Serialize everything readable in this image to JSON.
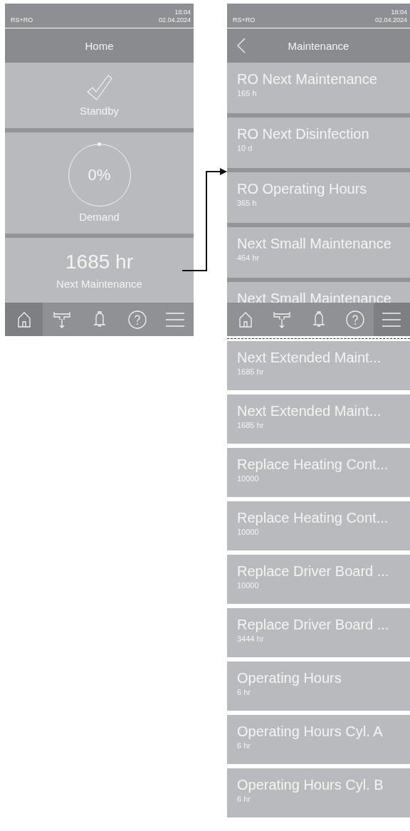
{
  "home_screen": {
    "status": {
      "system": "RS+RO",
      "time": "18:04",
      "date": "02.04.2024"
    },
    "back_button": false,
    "title": "Home",
    "tiles": [
      {
        "kind": "status",
        "label": "Standby"
      },
      {
        "kind": "gauge",
        "value": "0%",
        "label": "Demand"
      },
      {
        "kind": "value",
        "value": "1685 hr",
        "label": "Next Maintenance"
      }
    ],
    "nav": [
      {
        "kind": "home",
        "selected": true
      },
      {
        "kind": "valve",
        "selected": false
      },
      {
        "kind": "bell",
        "selected": false
      },
      {
        "kind": "help",
        "selected": false
      },
      {
        "kind": "menu",
        "selected": false
      }
    ]
  },
  "maintenance_screen": {
    "status": {
      "system": "RS+RO",
      "time": "18:04",
      "date": "02.04.2024"
    },
    "back_button": true,
    "title": "Maintenance",
    "items": [
      {
        "title": "RO Next Maintenance",
        "value": "165 h"
      },
      {
        "title": "RO Next Disinfection",
        "value": "10 d"
      },
      {
        "title": "RO Operating Hours",
        "value": "365 h"
      },
      {
        "title": "Next Small Maintenance",
        "value": "464 hr"
      },
      {
        "title": "Next Small Maintenance"
      }
    ],
    "nav": [
      {
        "kind": "home",
        "selected": false
      },
      {
        "kind": "valve",
        "selected": false
      },
      {
        "kind": "bell",
        "selected": false
      },
      {
        "kind": "help",
        "selected": false
      },
      {
        "kind": "menu",
        "selected": true
      }
    ]
  },
  "continued_items": [
    {
      "title": "Next Extended Maint...",
      "value": "1685 hr"
    },
    {
      "title": "Next Extended Maint...",
      "value": "1685 hr"
    },
    {
      "title": "Replace Heating Cont...",
      "value": "10000"
    },
    {
      "title": "Replace Heating Cont...",
      "value": "10000"
    },
    {
      "title": "Replace Driver Board ...",
      "value": "10000"
    },
    {
      "title": "Replace Driver Board ...",
      "value": "3444 hr"
    },
    {
      "title": "Operating Hours",
      "value": "6 hr"
    },
    {
      "title": "Operating Hours Cyl. A",
      "value": "6 hr"
    },
    {
      "title": "Operating Hours Cyl. B",
      "value": "6 hr"
    }
  ]
}
